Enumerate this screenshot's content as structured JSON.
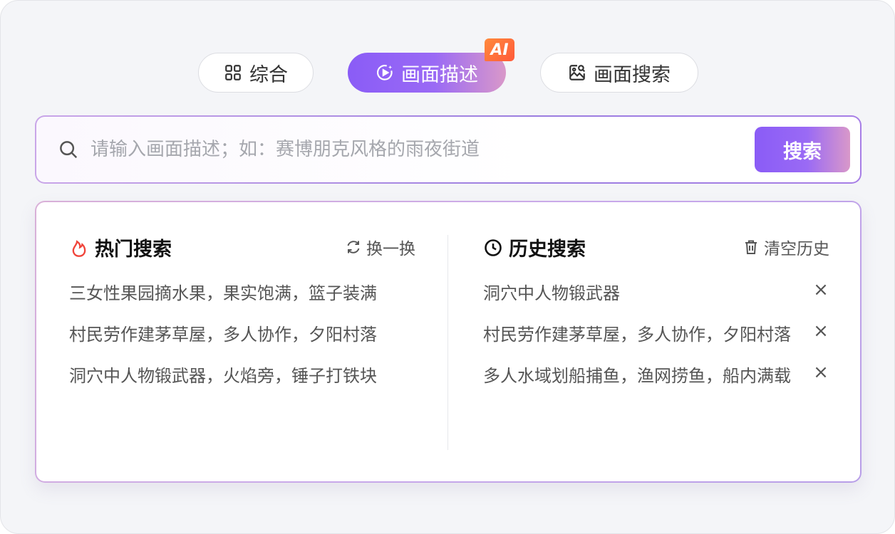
{
  "tabs": [
    {
      "label": "综合",
      "icon": "grid-icon"
    },
    {
      "label": "画面描述",
      "icon": "sparkle-play-icon",
      "active": true
    },
    {
      "label": "画面搜索",
      "icon": "image-search-icon"
    }
  ],
  "ai_badge": "AI",
  "search": {
    "placeholder": "请输入画面描述；如：赛博朋克风格的雨夜街道",
    "button_label": "搜索"
  },
  "hot": {
    "title": "热门搜索",
    "action_label": "换一换",
    "items": [
      "三女性果园摘水果，果实饱满，篮子装满",
      "村民劳作建茅草屋，多人协作，夕阳村落",
      "洞穴中人物锻武器，火焰旁，锤子打铁块"
    ]
  },
  "history": {
    "title": "历史搜索",
    "action_label": "清空历史",
    "items": [
      "洞穴中人物锻武器",
      "村民劳作建茅草屋，多人协作，夕阳村落",
      "多人水域划船捕鱼，渔网捞鱼，船内满载"
    ],
    "remove_glyph": "×"
  },
  "colors": {
    "accent": "#8a5cf6",
    "accent_end": "#d998c9",
    "hot_icon": "#f0443a",
    "badge": "#ff6a3a"
  }
}
